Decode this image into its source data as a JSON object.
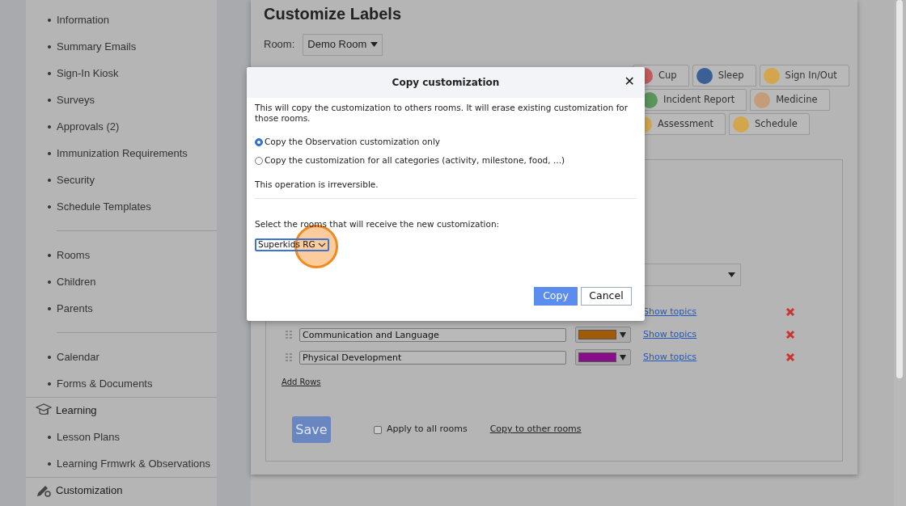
{
  "sidebar": {
    "groups": [
      {
        "items": [
          "Information",
          "Summary Emails",
          "Sign-In Kiosk",
          "Surveys",
          "Approvals (2)",
          "Immunization Requirements",
          "Security",
          "Schedule Templates"
        ]
      },
      {
        "items": [
          "Rooms",
          "Children",
          "Parents"
        ]
      },
      {
        "items": [
          "Calendar",
          "Forms & Documents"
        ]
      },
      {
        "heading": "Learning",
        "items": [
          "Lesson Plans",
          "Learning Frmwrk & Observations"
        ]
      },
      {
        "heading": "Customization"
      }
    ]
  },
  "page": {
    "title": "Customize Labels",
    "room_label": "Room:",
    "room_select": "Demo Room"
  },
  "tabs": [
    [
      {
        "label": "Cup",
        "color": "#c65a5e"
      },
      {
        "label": "Sleep",
        "color": "#3b5f97"
      },
      {
        "label": "Sign In/Out",
        "color": "#d3a64e"
      }
    ],
    [
      {
        "label": "Incident Report",
        "color": "#5b955b"
      },
      {
        "label": "Medicine",
        "color": "#c49c7a"
      }
    ],
    [
      {
        "label": "Assessment",
        "color": "#d3a64e"
      },
      {
        "label": "Schedule",
        "color": "#d3a64e"
      }
    ]
  ],
  "rows": [
    {
      "link": "Show topics"
    },
    {
      "label": "Communication and Language",
      "color": "#a05a08",
      "link": "Show topics"
    },
    {
      "label": "Physical Development",
      "color": "#880d88",
      "link": "Show topics"
    }
  ],
  "add_rows": "Add Rows",
  "save": "Save",
  "apply_all": {
    "label": "Apply to all rooms",
    "checked": false
  },
  "copy_link": "Copy to other rooms",
  "dialog": {
    "title": "Copy customization",
    "close": "✕",
    "message": "This will copy the customization to others rooms. It will erase existing customization for those rooms.",
    "options": [
      {
        "label": "Copy the Observation customization only",
        "selected": true
      },
      {
        "label": "Copy the customization for all categories (activity, milestone, food, ...)",
        "selected": false
      }
    ],
    "warning": "This operation is irreversible.",
    "select_label": "Select the rooms that will receive the new customization:",
    "room_select": "Superkids RG",
    "buttons": [
      "Copy",
      "Cancel"
    ]
  }
}
